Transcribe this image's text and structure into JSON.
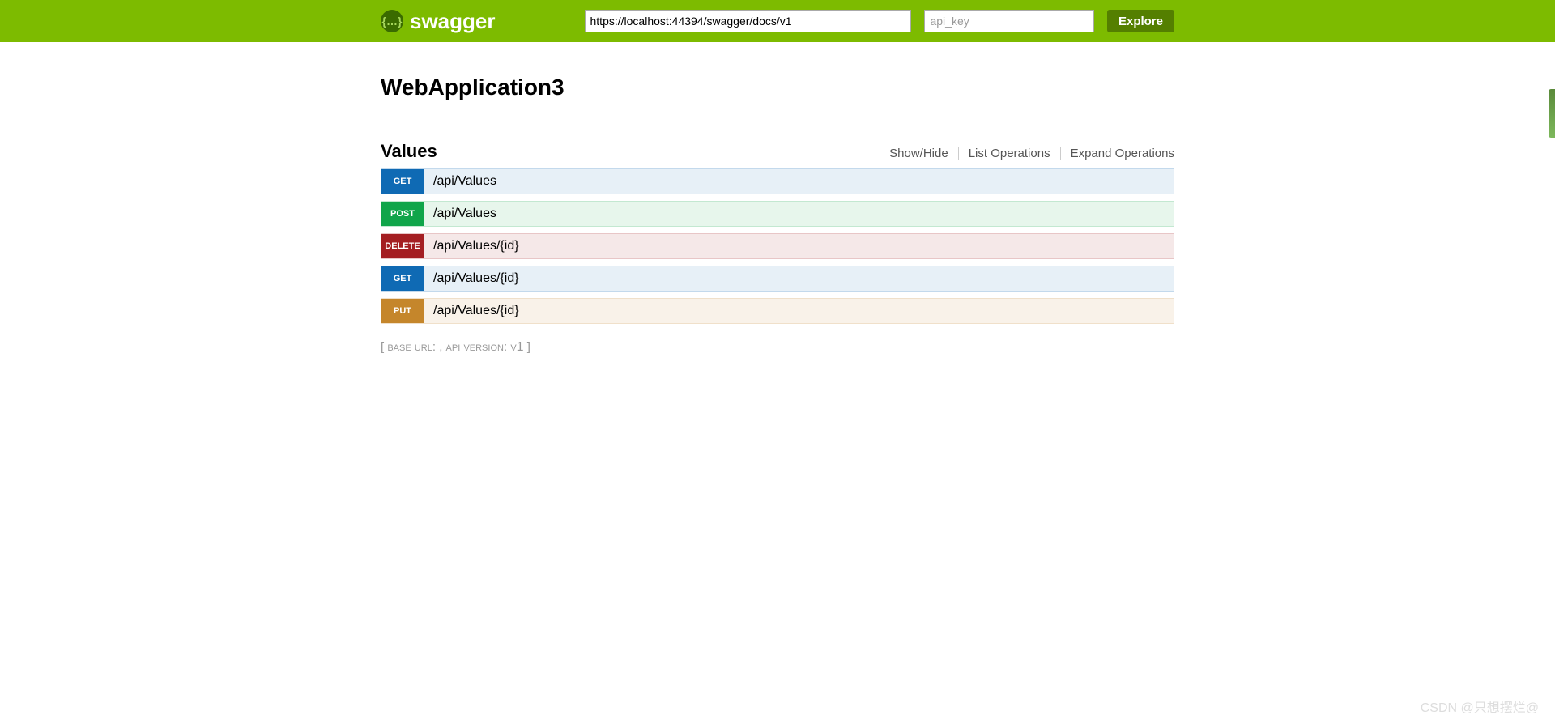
{
  "header": {
    "brand": "swagger",
    "url_value": "https://localhost:44394/swagger/docs/v1",
    "api_key_placeholder": "api_key",
    "explore_label": "Explore"
  },
  "app_title": "WebApplication3",
  "section": {
    "title": "Values",
    "actions": {
      "show_hide": "Show/Hide",
      "list_ops": "List Operations",
      "expand_ops": "Expand Operations"
    }
  },
  "operations": [
    {
      "method": "GET",
      "path": "/api/Values",
      "type": "get"
    },
    {
      "method": "POST",
      "path": "/api/Values",
      "type": "post"
    },
    {
      "method": "DELETE",
      "path": "/api/Values/{id}",
      "type": "delete"
    },
    {
      "method": "GET",
      "path": "/api/Values/{id}",
      "type": "get"
    },
    {
      "method": "PUT",
      "path": "/api/Values/{id}",
      "type": "put"
    }
  ],
  "footer": {
    "base_url_label": "base url",
    "api_version_label": "api version",
    "version": "v1"
  },
  "watermark": "CSDN @只想摆烂@"
}
